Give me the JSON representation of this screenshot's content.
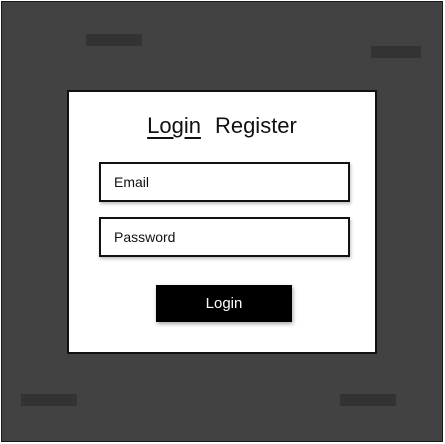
{
  "auth": {
    "tabs": [
      {
        "label": "Login",
        "active": true
      },
      {
        "label": "Register",
        "active": false
      }
    ],
    "email": {
      "placeholder": "Email",
      "value": ""
    },
    "password": {
      "placeholder": "Password",
      "value": ""
    },
    "submit_label": "Login"
  },
  "colors": {
    "backdrop": "#424242",
    "card": "#ffffff",
    "button": "#000000"
  }
}
